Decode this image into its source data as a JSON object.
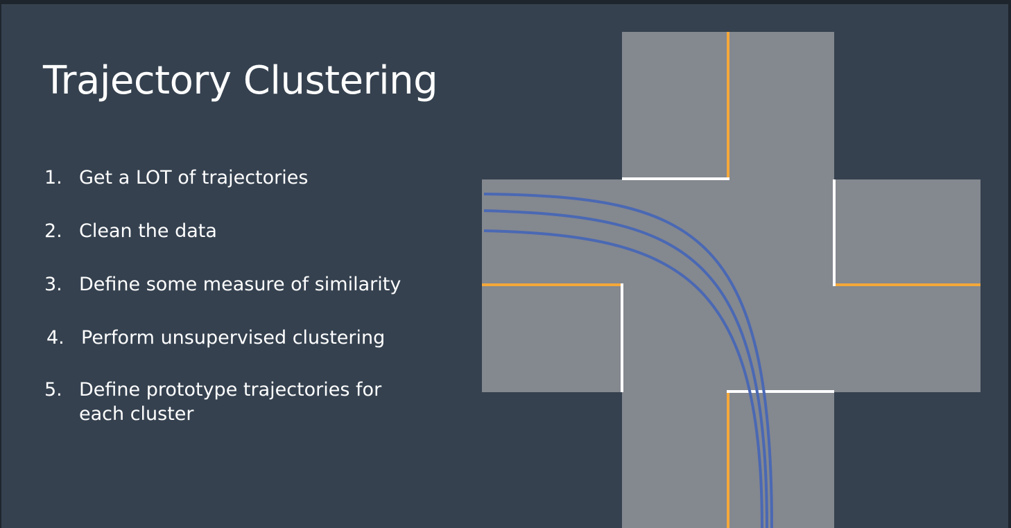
{
  "slide": {
    "title": "Trajectory Clustering",
    "steps": [
      {
        "num": "1.",
        "text": "Get a LOT of trajectories"
      },
      {
        "num": "2.",
        "text": "Clean the data"
      },
      {
        "num": "3.",
        "text": "Define some measure of similarity"
      },
      {
        "num": "4.",
        "text": "Perform unsupervised clustering"
      },
      {
        "num": "5.",
        "text": "Define prototype trajectories for each cluster"
      }
    ]
  },
  "diagram": {
    "road_color": "#84888f",
    "center_line_color": "#f4a83a",
    "stop_line_color": "#ffffff",
    "trajectory_color": "#4a68b3",
    "trajectory_count": 3
  }
}
